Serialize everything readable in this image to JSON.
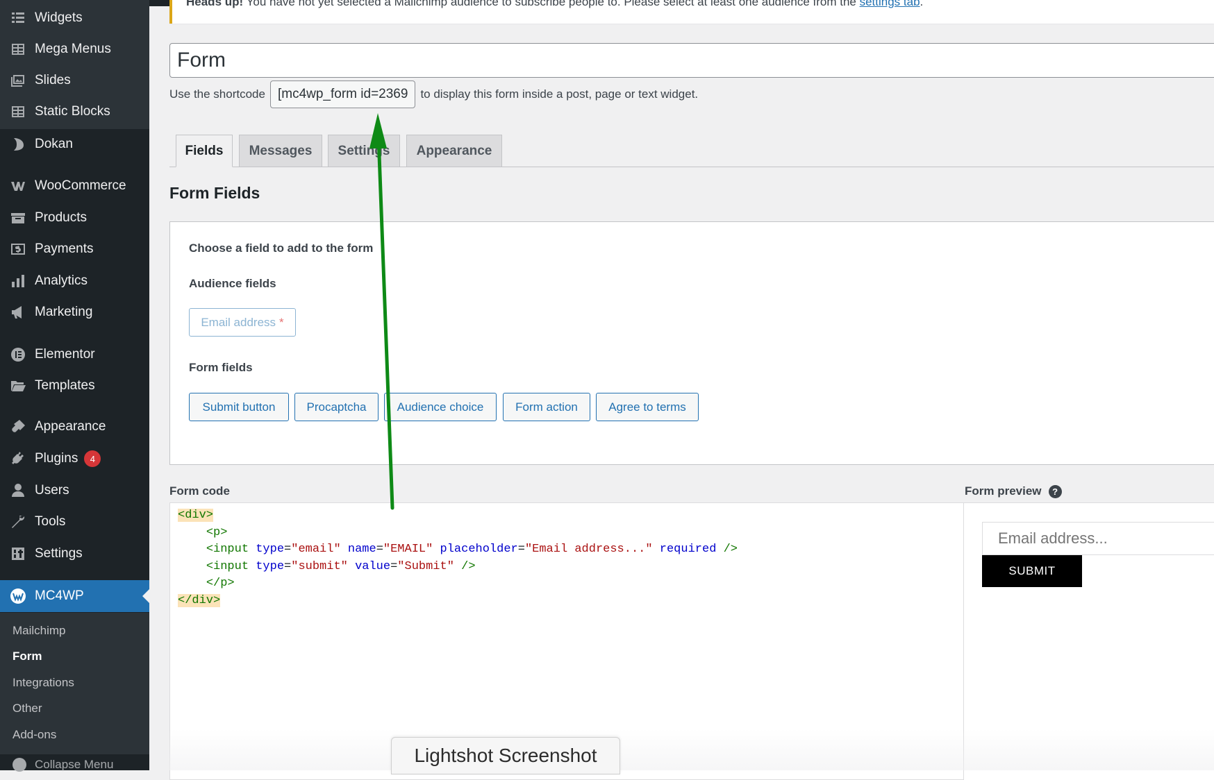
{
  "sidebar": {
    "items": [
      {
        "label": "Widgets",
        "icon": "widgets-icon"
      },
      {
        "label": "Mega Menus",
        "icon": "mega-menus-icon"
      },
      {
        "label": "Slides",
        "icon": "slides-icon"
      },
      {
        "label": "Static Blocks",
        "icon": "static-blocks-icon"
      },
      {
        "label": "Dokan",
        "icon": "dokan-icon"
      },
      {
        "label": "WooCommerce",
        "icon": "woocommerce-icon"
      },
      {
        "label": "Products",
        "icon": "products-icon"
      },
      {
        "label": "Payments",
        "icon": "payments-icon"
      },
      {
        "label": "Analytics",
        "icon": "analytics-icon"
      },
      {
        "label": "Marketing",
        "icon": "marketing-icon"
      },
      {
        "label": "Elementor",
        "icon": "elementor-icon"
      },
      {
        "label": "Templates",
        "icon": "templates-icon"
      },
      {
        "label": "Appearance",
        "icon": "appearance-icon"
      },
      {
        "label": "Plugins",
        "icon": "plugins-icon",
        "badge": "4"
      },
      {
        "label": "Users",
        "icon": "users-icon"
      },
      {
        "label": "Tools",
        "icon": "tools-icon"
      },
      {
        "label": "Settings",
        "icon": "settings-icon"
      },
      {
        "label": "MC4WP",
        "icon": "mc4wp-icon",
        "current": true
      }
    ],
    "submenu": [
      "Mailchimp",
      "Form",
      "Integrations",
      "Other",
      "Add-ons"
    ],
    "submenu_active": "Form",
    "collapse_label": "Collapse Menu"
  },
  "notice": {
    "strong": "Heads up!",
    "text": " You have not yet selected a Mailchimp audience to subscribe people to. Please select at least one audience from the ",
    "link": "settings tab",
    "end": "."
  },
  "form": {
    "title_value": "Form",
    "shortcode_prefix": "Use the shortcode",
    "shortcode": "[mc4wp_form id=2369",
    "shortcode_suffix": "to display this form inside a post, page or text widget."
  },
  "tabs": [
    {
      "label": "Fields",
      "active": true
    },
    {
      "label": "Messages"
    },
    {
      "label": "Settings"
    },
    {
      "label": "Appearance"
    }
  ],
  "fields_section": {
    "title": "Form Fields",
    "choose_label": "Choose a field to add to the form",
    "audience_fields_label": "Audience fields",
    "email_field_label": "Email address",
    "email_required_mark": "*",
    "form_fields_label": "Form fields",
    "buttons": [
      "Submit button",
      "Procaptcha",
      "Audience choice",
      "Form action",
      "Agree to terms"
    ]
  },
  "code": {
    "label": "Form code",
    "lines": {
      "l1": "<div>",
      "l2": "<p>",
      "l3_tag": "<input",
      "l3_a1": "type",
      "l3_v1": "\"email\"",
      "l3_a2": "name",
      "l3_v2": "\"EMAIL\"",
      "l3_a3": "placeholder",
      "l3_v3": "\"Email address...\"",
      "l3_a4": "required",
      "l3_end": "/>",
      "l4_tag": "<input",
      "l4_a1": "type",
      "l4_v1": "\"submit\"",
      "l4_a2": "value",
      "l4_v2": "\"Submit\"",
      "l4_end": "/>",
      "l5": "</p>",
      "l6": "</div>"
    }
  },
  "preview": {
    "label": "Form preview",
    "help": "?",
    "email_placeholder": "Email address...",
    "submit_label": "SUBMIT"
  },
  "overlay": {
    "lightshot_label": "Lightshot Screenshot",
    "arrow_color": "#0e8a16"
  },
  "colors": {
    "admin_bar": "#1d2327",
    "sidebar_sub": "#2c3338",
    "accent": "#2271b1",
    "badge": "#d63638",
    "notice_border": "#dba617"
  }
}
